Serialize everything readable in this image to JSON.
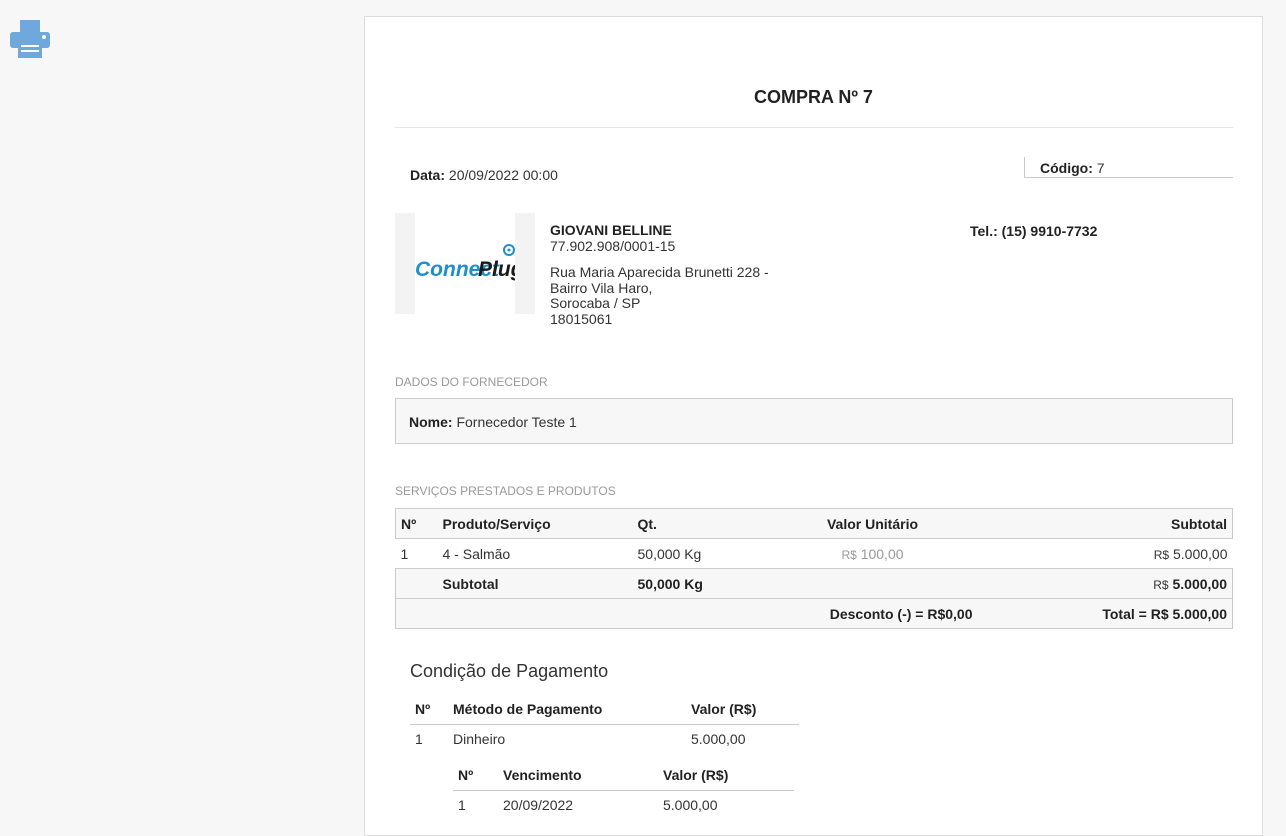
{
  "toolbar": {
    "print_icon": "printer-icon",
    "accent_color": "#6fa8dc"
  },
  "document": {
    "title": "COMPRA Nº 7",
    "data_label": "Data:",
    "data_value": "20/09/2022 00:00",
    "codigo_label": "Código:",
    "codigo_value": "7"
  },
  "company": {
    "logo_text_1": "Connect",
    "logo_text_2": "Plug",
    "name": "GIOVANI BELLINE",
    "cnpj": "77.902.908/0001-15",
    "address_1": "Rua Maria Aparecida Brunetti 228 -",
    "address_2": "Bairro Vila Haro,",
    "address_3": "Sorocaba / SP",
    "address_4": "18015061",
    "tel_label": "Tel.:",
    "tel_value": "(15) 9910-7732"
  },
  "fornecedor": {
    "section_label": "DADOS DO FORNECEDOR",
    "nome_label": "Nome:",
    "nome_value": "Fornecedor Teste 1"
  },
  "items": {
    "section_label": "SERVIÇOS PRESTADOS E PRODUTOS",
    "headers": {
      "n": "Nº",
      "produto": "Produto/Serviço",
      "qt": "Qt.",
      "valor": "Valor Unitário",
      "subtotal": "Subtotal"
    },
    "rows": [
      {
        "n": "1",
        "produto": "4 - Salmão",
        "qt": "50,000 Kg",
        "valor_cur": "R$",
        "valor": "100,00",
        "sub_cur": "R$",
        "subtotal": "5.000,00"
      }
    ],
    "subtotal_row": {
      "label": "Subtotal",
      "qt": "50,000 Kg",
      "cur": "R$",
      "value": "5.000,00"
    },
    "total_row": {
      "desconto": "Desconto (-) = R$0,00",
      "total": "Total = R$ 5.000,00"
    }
  },
  "payment": {
    "title": "Condição de Pagamento",
    "headers": {
      "n": "Nº",
      "metodo": "Método de Pagamento",
      "valor": "Valor (R$)"
    },
    "rows": [
      {
        "n": "1",
        "metodo": "Dinheiro",
        "valor": "5.000,00"
      }
    ],
    "installments": {
      "headers": {
        "n": "Nº",
        "vencimento": "Vencimento",
        "valor": "Valor (R$)"
      },
      "rows": [
        {
          "n": "1",
          "vencimento": "20/09/2022",
          "valor": "5.000,00"
        }
      ]
    }
  }
}
